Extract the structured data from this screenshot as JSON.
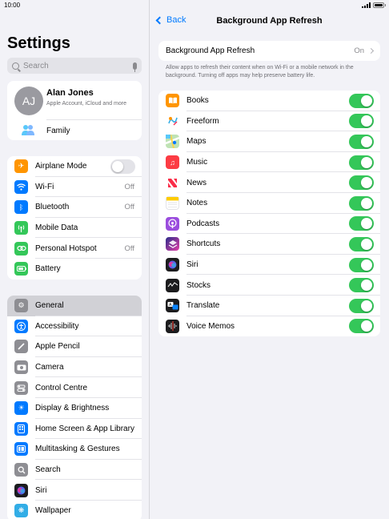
{
  "status": {
    "time": "10:00"
  },
  "sidebar": {
    "title": "Settings",
    "search_placeholder": "Search",
    "profile": {
      "initials": "AJ",
      "name": "Alan Jones",
      "subtitle": "Apple Account, iCloud and more",
      "family": "Family"
    },
    "group1": [
      {
        "label": "Airplane Mode",
        "icon": "airplane-icon",
        "color": "#ff9500",
        "toggle": "off"
      },
      {
        "label": "Wi-Fi",
        "icon": "wifi-icon",
        "color": "#007aff",
        "value": "Off"
      },
      {
        "label": "Bluetooth",
        "icon": "bluetooth-icon",
        "color": "#007aff",
        "value": "Off"
      },
      {
        "label": "Mobile Data",
        "icon": "antenna-icon",
        "color": "#34c759"
      },
      {
        "label": "Personal Hotspot",
        "icon": "hotspot-icon",
        "color": "#34c759",
        "value": "Off"
      },
      {
        "label": "Battery",
        "icon": "battery-icon",
        "color": "#34c759"
      }
    ],
    "group2": [
      {
        "label": "General",
        "icon": "gear-icon",
        "color": "#8e8e93",
        "selected": true
      },
      {
        "label": "Accessibility",
        "icon": "accessibility-icon",
        "color": "#007aff"
      },
      {
        "label": "Apple Pencil",
        "icon": "pencil-icon",
        "color": "#8e8e93"
      },
      {
        "label": "Camera",
        "icon": "camera-icon",
        "color": "#8e8e93"
      },
      {
        "label": "Control Centre",
        "icon": "control-centre-icon",
        "color": "#8e8e93"
      },
      {
        "label": "Display & Brightness",
        "icon": "brightness-icon",
        "color": "#007aff"
      },
      {
        "label": "Home Screen & App Library",
        "icon": "home-screen-icon",
        "color": "#007aff"
      },
      {
        "label": "Multitasking & Gestures",
        "icon": "multitasking-icon",
        "color": "#007aff"
      },
      {
        "label": "Search",
        "icon": "search-icon",
        "color": "#8e8e93"
      },
      {
        "label": "Siri",
        "icon": "siri-icon",
        "color": "#1c1c1e"
      },
      {
        "label": "Wallpaper",
        "icon": "wallpaper-icon",
        "color": "#32ade6"
      }
    ]
  },
  "detail": {
    "back_label": "Back",
    "title": "Background App Refresh",
    "main_row": {
      "label": "Background App Refresh",
      "value": "On"
    },
    "description": "Allow apps to refresh their content when on Wi-Fi or a mobile network in the background. Turning off apps may help preserve battery life.",
    "apps": [
      {
        "label": "Books",
        "icon": "books-icon",
        "color": "#ff9500",
        "on": true
      },
      {
        "label": "Freeform",
        "icon": "freeform-icon",
        "color": "#ffffff",
        "on": true
      },
      {
        "label": "Maps",
        "icon": "maps-icon",
        "color": "#5ac8fa",
        "on": true
      },
      {
        "label": "Music",
        "icon": "music-icon",
        "color": "#fc3c44",
        "on": true
      },
      {
        "label": "News",
        "icon": "news-icon",
        "color": "#ffffff",
        "on": true
      },
      {
        "label": "Notes",
        "icon": "notes-icon",
        "color": "#ffffff",
        "on": true
      },
      {
        "label": "Podcasts",
        "icon": "podcasts-icon",
        "color": "#9b4dde",
        "on": true
      },
      {
        "label": "Shortcuts",
        "icon": "shortcuts-icon",
        "color": "#3a3ab0",
        "on": true
      },
      {
        "label": "Siri",
        "icon": "siri-icon",
        "color": "#1c1c1e",
        "on": true
      },
      {
        "label": "Stocks",
        "icon": "stocks-icon",
        "color": "#1c1c1e",
        "on": true
      },
      {
        "label": "Translate",
        "icon": "translate-icon",
        "color": "#1c1c1e",
        "on": true
      },
      {
        "label": "Voice Memos",
        "icon": "voice-memos-icon",
        "color": "#1c1c1e",
        "on": true
      }
    ]
  }
}
